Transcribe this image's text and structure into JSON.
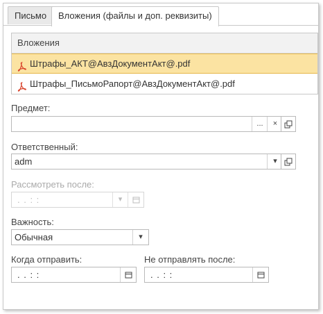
{
  "tabs": [
    {
      "label": "Письмо"
    },
    {
      "label": "Вложения (файлы и доп. реквизиты)"
    }
  ],
  "attachments": {
    "header": "Вложения",
    "items": [
      {
        "name": "Штрафы_АКТ@АвзДокументАкт@.pdf",
        "selected": true
      },
      {
        "name": "Штрафы_ПисьмоРапорт@АвзДокументАкт@.pdf",
        "selected": false
      }
    ]
  },
  "subject": {
    "label": "Предмет:",
    "value": "",
    "choose_btn": "...",
    "clear_btn": "×"
  },
  "responsible": {
    "label": "Ответственный:",
    "value": "adm"
  },
  "review_after": {
    "label": "Рассмотреть после:",
    "value": " .  .      :  :"
  },
  "importance": {
    "label": "Важность:",
    "value": "Обычная"
  },
  "send_when": {
    "label": "Когда отправить:",
    "value": " .  .      :  :"
  },
  "not_send_after": {
    "label": "Не отправлять после:",
    "value": " .  .      :  :"
  },
  "colors": {
    "accent_selected": "#fbe3a2",
    "pdf_red": "#d9432b"
  }
}
